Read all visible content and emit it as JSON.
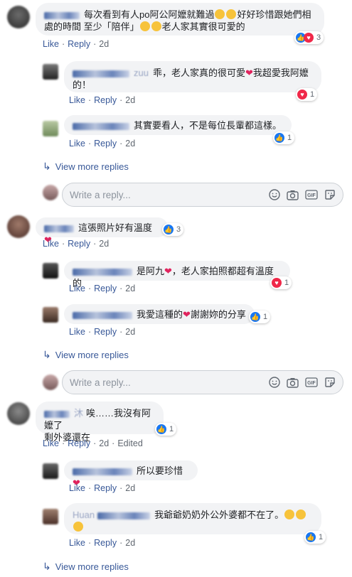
{
  "ui": {
    "like": "Like",
    "reply": "Reply",
    "view_more": "View more replies",
    "placeholder": "Write a reply...",
    "sep": "·"
  },
  "colors": {
    "link": "#385898",
    "like_blue": "#1877f2",
    "love_red": "#f02849",
    "bubble": "#f2f3f5"
  },
  "c1": {
    "text_a": "每次看到有人po阿公阿嬤就難過",
    "text_b": "好好珍惜跟她們相處的時間 至少「陪伴」",
    "text_c": "老人家其實很可愛的",
    "time": "2d",
    "reactions": "3"
  },
  "r1": {
    "name_tail": "zuu",
    "text_a": "乖，老人家真的很可愛",
    "text_b": "我超愛我阿嬤的！",
    "time": "2d",
    "reactions": "1"
  },
  "r2": {
    "text": "其實要看人，不是每位長輩都這樣。",
    "time": "2d",
    "reactions": "1"
  },
  "c2": {
    "text": "這張照片好有溫度",
    "time": "2d",
    "reactions": "3"
  },
  "r3": {
    "text_a": "是阿九",
    "text_b": "，老人家拍照都超有溫度的",
    "time": "2d",
    "reactions": "1"
  },
  "r4": {
    "text_a": "我愛這種的",
    "text_b": "謝謝妳的分享",
    "time": "2d",
    "reactions": "1"
  },
  "c3": {
    "name_tail": "沐",
    "text_a": "唉……我沒有阿嬤了",
    "text_b": "剩外婆還在",
    "time": "2d",
    "edited": "Edited",
    "reactions": "1"
  },
  "r5": {
    "text": "所以要珍惜",
    "time": "2d"
  },
  "r6": {
    "name_tail": "Huan",
    "text": "我爺爺奶奶外公外婆都不在了。",
    "time": "2d",
    "reactions": "1"
  },
  "icons": [
    "share-arrow-icon",
    "emoji-icon",
    "camera-icon",
    "gif-icon",
    "sticker-icon"
  ]
}
